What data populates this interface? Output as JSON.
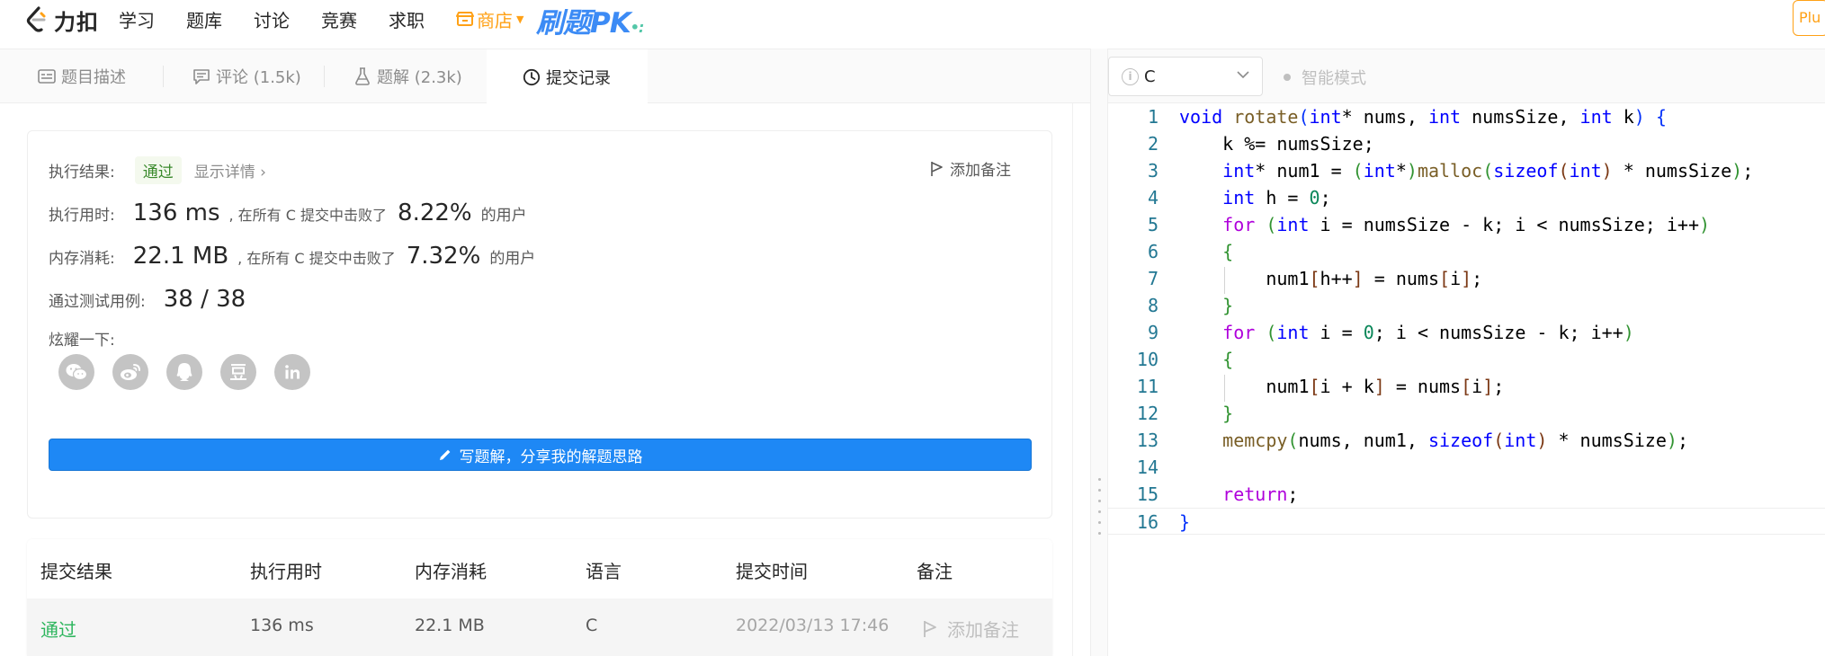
{
  "nav": {
    "logo_text": "力扣",
    "items": [
      "学习",
      "题库",
      "讨论",
      "竞赛",
      "求职"
    ],
    "store_label": "商店",
    "pk_label": "刷题PK",
    "plus_label": "Plu"
  },
  "tabs": [
    {
      "label": "题目描述",
      "icon": "description-icon"
    },
    {
      "label": "评论 (1.5k)",
      "icon": "comment-icon"
    },
    {
      "label": "题解 (2.3k)",
      "icon": "flask-icon"
    },
    {
      "label": "提交记录",
      "icon": "clock-icon",
      "active": true
    }
  ],
  "result": {
    "status_label": "执行结果:",
    "status_value": "通过",
    "detail_link": "显示详情 ›",
    "add_note": "添加备注",
    "runtime_label": "执行用时:",
    "runtime_value": "136 ms",
    "runtime_text": ", 在所有 C 提交中击败了",
    "runtime_pct": "8.22%",
    "users_text": "的用户",
    "memory_label": "内存消耗:",
    "memory_value": "22.1 MB",
    "memory_text": ", 在所有 C 提交中击败了",
    "memory_pct": "7.32%",
    "tests_label": "通过测试用例:",
    "tests_value": "38 / 38",
    "share_label": "炫耀一下:",
    "share_icons": [
      "wechat-icon",
      "weibo-icon",
      "qq-icon",
      "douban-icon",
      "linkedin-icon"
    ],
    "write_button": "写题解，分享我的解题思路"
  },
  "table": {
    "headers": [
      "提交结果",
      "执行用时",
      "内存消耗",
      "语言",
      "提交时间",
      "备注"
    ],
    "rows": [
      {
        "result": "通过",
        "runtime": "136 ms",
        "memory": "22.1 MB",
        "lang": "C",
        "time": "2022/03/13 17:46",
        "note": "添加备注"
      }
    ]
  },
  "editor": {
    "language": "C",
    "smart_mode": "智能模式",
    "line_numbers": [
      "1",
      "2",
      "3",
      "4",
      "5",
      "6",
      "7",
      "8",
      "9",
      "10",
      "11",
      "12",
      "13",
      "14",
      "15",
      "16"
    ]
  },
  "colors": {
    "accent_blue": "#1e88f5",
    "pass_green": "#2db55d",
    "store_orange": "#ffa116"
  }
}
